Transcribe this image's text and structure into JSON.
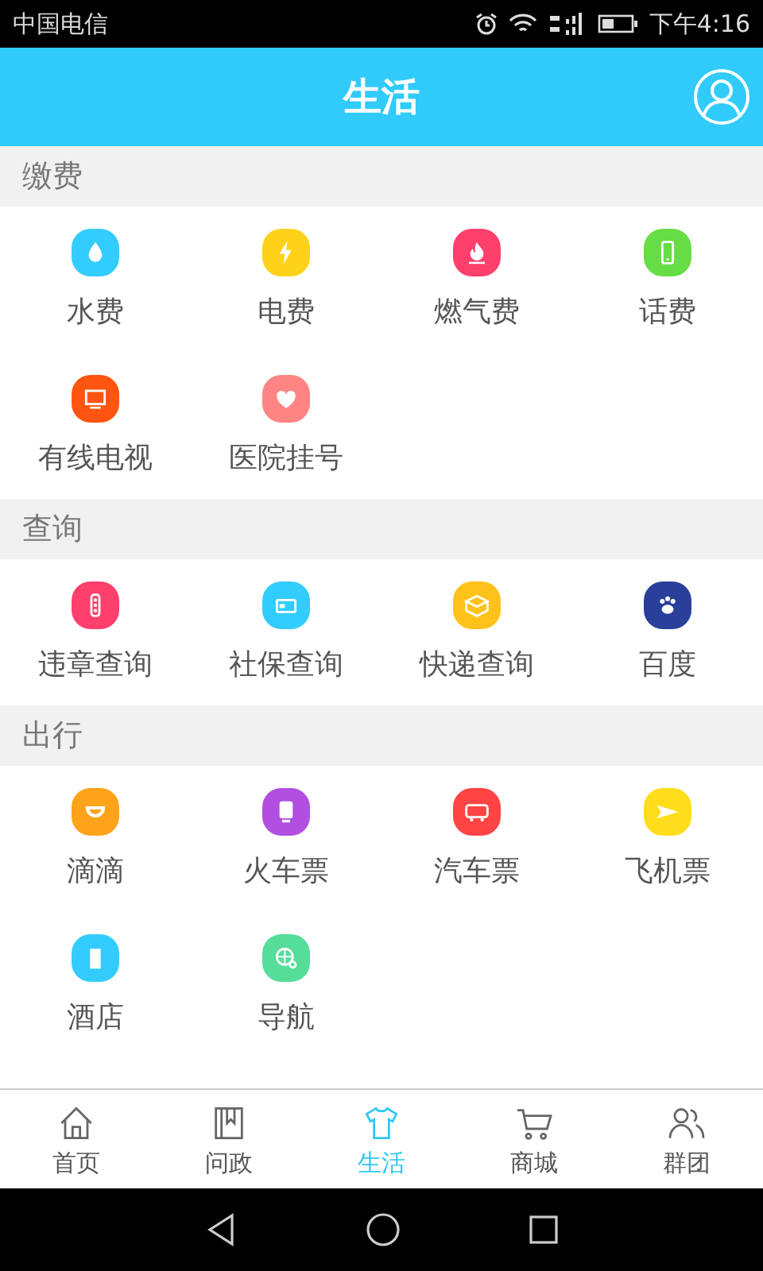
{
  "status_bar": {
    "carrier": "中国电信",
    "time": "下午4:16"
  },
  "header": {
    "title": "生活"
  },
  "sections": [
    {
      "title": "缴费",
      "items": [
        {
          "label": "水费",
          "color": "#33ccff"
        },
        {
          "label": "电费",
          "color": "#ffd21a"
        },
        {
          "label": "燃气费",
          "color": "#ff3f6c"
        },
        {
          "label": "话费",
          "color": "#66dd44"
        },
        {
          "label": "有线电视",
          "color": "#ff5511"
        },
        {
          "label": "医院挂号",
          "color": "#ff8585"
        }
      ]
    },
    {
      "title": "查询",
      "items": [
        {
          "label": "违章查询",
          "color": "#ff3f6c"
        },
        {
          "label": "社保查询",
          "color": "#33ccff"
        },
        {
          "label": "快递查询",
          "color": "#ffc21a"
        },
        {
          "label": "百度",
          "color": "#2a3f9a"
        }
      ]
    },
    {
      "title": "出行",
      "items": [
        {
          "label": "滴滴",
          "color": "#ffa31a"
        },
        {
          "label": "火车票",
          "color": "#b04fe0"
        },
        {
          "label": "汽车票",
          "color": "#ff4444"
        },
        {
          "label": "飞机票",
          "color": "#ffdd1a"
        },
        {
          "label": "酒店",
          "color": "#33ccff"
        },
        {
          "label": "导航",
          "color": "#55dd99"
        }
      ]
    }
  ],
  "tab_bar": [
    {
      "label": "首页",
      "selected": false
    },
    {
      "label": "问政",
      "selected": false
    },
    {
      "label": "生活",
      "selected": true
    },
    {
      "label": "商城",
      "selected": false
    },
    {
      "label": "群团",
      "selected": false
    }
  ]
}
